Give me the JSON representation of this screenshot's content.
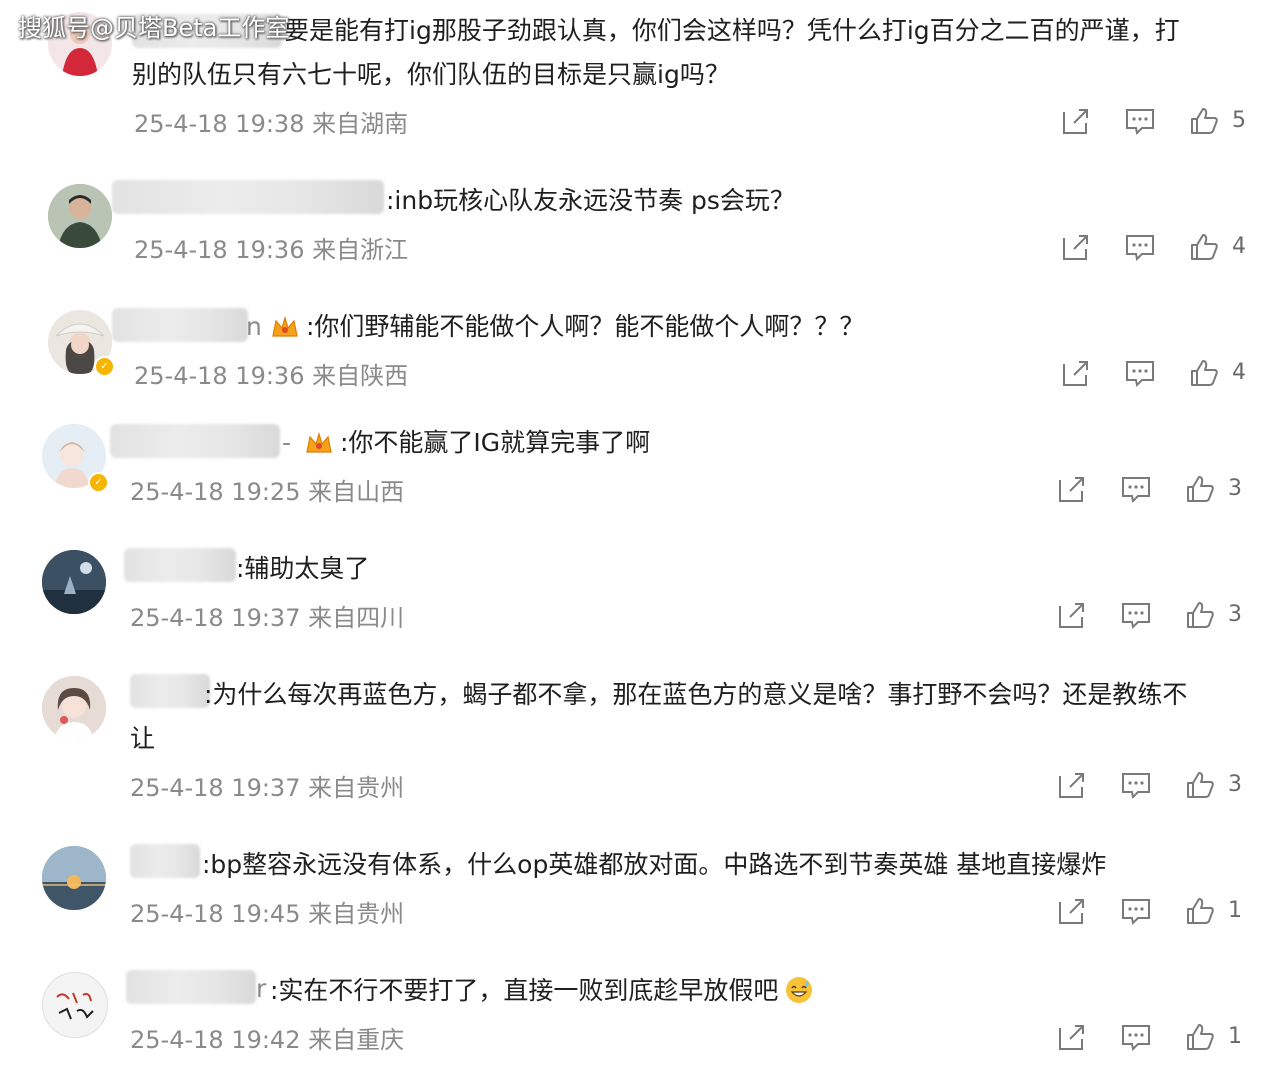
{
  "watermark": "搜狐号@贝塔Beta工作室",
  "comments": [
    {
      "avatar_icon": "red-figure-avatar-icon",
      "name_fragment": "",
      "text_line1": "要是能有打ig那股子劲跟认真，你们会这样吗？凭什么打ig百分之二百的严谨，打",
      "text_line2": "别的队伍只有六七十呢，你们队伍的目标是只赢ig吗？",
      "meta": "25-4-18 19:38 来自湖南",
      "likes": "5"
    },
    {
      "avatar_icon": "man-portrait-avatar-icon",
      "name_fragment": "",
      "text_line1": ":inb玩核心队友永远没节奏 ps会玩？",
      "meta": "25-4-18 19:36 来自浙江",
      "likes": "4"
    },
    {
      "avatar_icon": "girl-hat-avatar-icon",
      "name_fragment": "n",
      "text_line1": ":你们野辅能不能做个人啊？能不能做个人啊？？？",
      "meta": "25-4-18 19:36 来自陕西",
      "likes": "4"
    },
    {
      "avatar_icon": "cartoon-avatar-icon",
      "name_fragment": "-",
      "text_line1": ":你不能赢了IG就算完事了啊",
      "meta": "25-4-18 19:25 来自山西",
      "likes": "3"
    },
    {
      "avatar_icon": "night-scene-avatar-icon",
      "name_fragment": "",
      "text_line1": ":辅助太臭了",
      "meta": "25-4-18 19:37 来自四川",
      "likes": "3"
    },
    {
      "avatar_icon": "anime-girl-avatar-icon",
      "name_fragment": "",
      "text_line1": ":为什么每次再蓝色方，蝎子都不拿，那在蓝色方的意义是啥？事打野不会吗？还是教练不",
      "text_line2": "让",
      "meta": "25-4-18 19:37 来自贵州",
      "likes": "3"
    },
    {
      "avatar_icon": "sunset-sea-avatar-icon",
      "name_fragment": "",
      "text_line1": ":bp整容永远没有体系，什么op英雄都放对面。中路选不到节奏英雄 基地直接爆炸",
      "meta": "25-4-18 19:45 来自贵州",
      "likes": "1"
    },
    {
      "avatar_icon": "handwriting-avatar-icon",
      "name_fragment": "r",
      "text_line1": ":实在不行不要打了，直接一败到底趁早放假吧",
      "meta": "25-4-18 19:42 来自重庆",
      "likes": "1"
    }
  ]
}
